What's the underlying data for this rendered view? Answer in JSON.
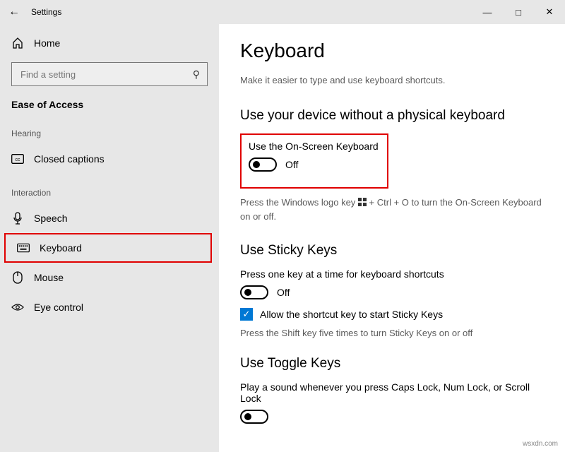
{
  "titlebar": {
    "title": "Settings"
  },
  "sidebar": {
    "home_label": "Home",
    "search_placeholder": "Find a setting",
    "section_header": "Ease of Access",
    "group_hearing": "Hearing",
    "group_interaction": "Interaction",
    "items_hearing": [
      {
        "label": "Closed captions"
      }
    ],
    "items_interaction": [
      {
        "label": "Speech"
      },
      {
        "label": "Keyboard"
      },
      {
        "label": "Mouse"
      },
      {
        "label": "Eye control"
      }
    ]
  },
  "main": {
    "title": "Keyboard",
    "description": "Make it easier to type and use keyboard shortcuts.",
    "section1": {
      "heading": "Use your device without a physical keyboard",
      "setting_label": "Use the On-Screen Keyboard",
      "toggle_state": "Off",
      "hint_prefix": "Press the Windows logo key ",
      "hint_suffix": " + Ctrl + O to turn the On-Screen Keyboard on or off."
    },
    "section2": {
      "heading": "Use Sticky Keys",
      "setting_label": "Press one key at a time for keyboard shortcuts",
      "toggle_state": "Off",
      "checkbox_label": "Allow the shortcut key to start Sticky Keys",
      "hint": "Press the Shift key five times to turn Sticky Keys on or off"
    },
    "section3": {
      "heading": "Use Toggle Keys",
      "setting_label": "Play a sound whenever you press Caps Lock, Num Lock, or Scroll Lock"
    }
  },
  "watermark": "wsxdn.com"
}
